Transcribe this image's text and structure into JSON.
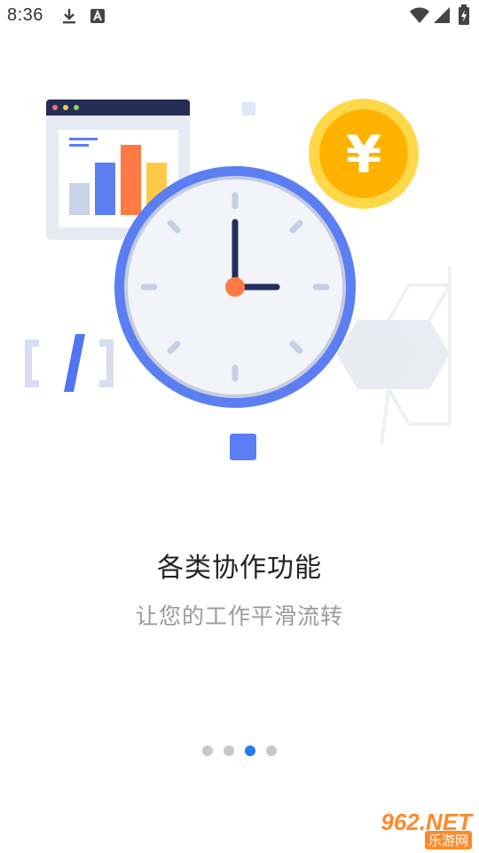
{
  "status_bar": {
    "time": "8:36",
    "left_icons": [
      "download-icon",
      "font-a-icon"
    ],
    "right_icons": [
      "wifi-icon",
      "signal-icon",
      "battery-icon"
    ]
  },
  "illustration": {
    "icons": [
      "bar-chart-window-icon",
      "clock-icon",
      "yuan-coin-icon",
      "code-brackets-icon",
      "hexagon-network-icon"
    ],
    "coin_symbol": "¥",
    "code_symbol": "[/]"
  },
  "onboarding": {
    "title": "各类协作功能",
    "subtitle": "让您的工作平滑流转",
    "page_count": 4,
    "active_page": 3
  },
  "watermark": {
    "brand": "962.NET",
    "name": "乐游网"
  },
  "colors": {
    "accent_blue": "#1e7cf2",
    "clock_ring": "#5b7ff2",
    "clock_hand": "#23305e",
    "coin": "#ffb300",
    "bar_orange": "#ff7a45",
    "dot_inactive": "#c8c8c8"
  }
}
